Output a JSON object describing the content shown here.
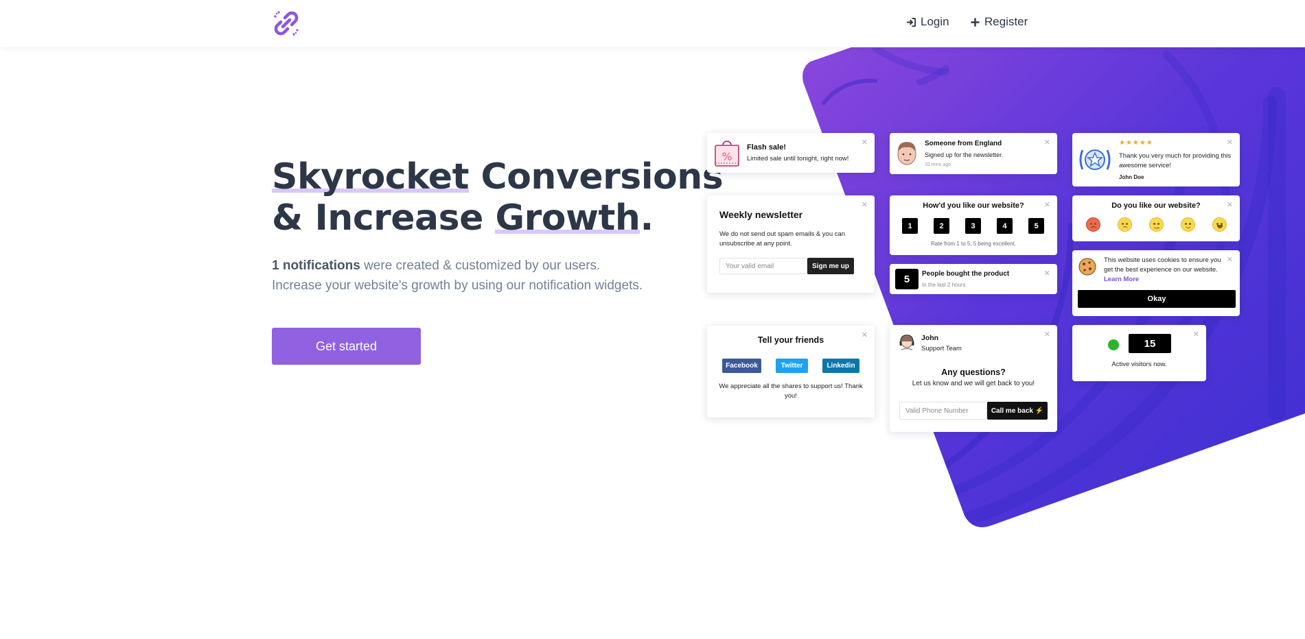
{
  "nav": {
    "login_label": "Login",
    "register_label": "Register"
  },
  "hero": {
    "title_line1_hl": "Skyrocket",
    "title_line1_rest": " Conversions",
    "title_line2_pre": "& Increase ",
    "title_line2_hl": "Growth",
    "title_line2_end": ".",
    "count_bold": "1 notifications",
    "count_rest": " were created & customized by our users.",
    "subtitle_line2": "Increase your website's growth by using our notification widgets.",
    "cta_label": "Get started"
  },
  "widgets": {
    "flash": {
      "title": "Flash sale!",
      "text": "Limited sale until tonight, right now!",
      "icon": "shopping-bag-icon"
    },
    "someone": {
      "title": "Someone from England",
      "text": "Signed up for the newsletter.",
      "time": "10 mins ago"
    },
    "review": {
      "stars": "★★★★★",
      "text": "Thank you very much for providing this awesome service!",
      "author": "John Doe"
    },
    "newsletter": {
      "title": "Weekly newsletter",
      "text": "We do not send out spam emails & you can unsubscribe at any point.",
      "placeholder": "Your valid email",
      "button": "Sign me up"
    },
    "rating": {
      "title": "How'd you like our website?",
      "numbers": [
        "1",
        "2",
        "3",
        "4",
        "5"
      ],
      "footer": "Rate from 1 to 5, 5 being excellent."
    },
    "emoji": {
      "title": "Do you like our website?"
    },
    "bought": {
      "count": "5",
      "title": "People bought the product",
      "text": "In the last 2 hours"
    },
    "cookie": {
      "text": "This website uses cookies to ensure you get the best experience on our website.",
      "link": "Learn More",
      "button": "Okay"
    },
    "share": {
      "title": "Tell your friends",
      "facebook": "Facebook",
      "twitter": "Twitter",
      "linkedin": "Linkedin",
      "text": "We appreciate all the shares to support us! Thank you!"
    },
    "support": {
      "name": "John",
      "role": "Support Team",
      "title": "Any questions?",
      "text": "Let us know and we will get back to you!",
      "placeholder": "Valid Phone Number",
      "button": "Call me back ⚡"
    },
    "visitors": {
      "count": "15",
      "text": "Active visitors now."
    }
  },
  "colors": {
    "accent": "#9061e0",
    "heading": "#2d3748",
    "muted": "#718096",
    "bg_gradient_start": "#7b44e0",
    "bg_gradient_end": "#3a2fd0",
    "facebook": "#3b5998",
    "twitter": "#1da1f2",
    "linkedin": "#0e76a8",
    "online": "#2ab52a"
  }
}
